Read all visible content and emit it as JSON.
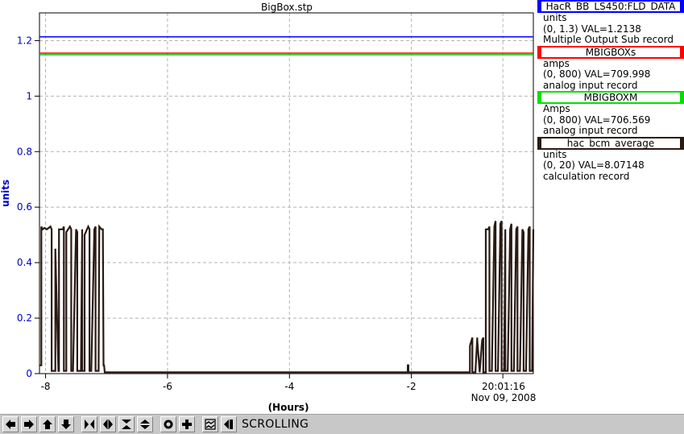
{
  "chart_data": {
    "type": "line",
    "title": "BigBox.stp",
    "xlabel": "(Hours)",
    "ylabel": "units",
    "xlim": [
      -8.1,
      0
    ],
    "ylim": [
      0,
      1.3
    ],
    "x_ticks": [
      "-8",
      "-6",
      "-4",
      "-2"
    ],
    "y_ticks": [
      "0",
      "0.2",
      "0.4",
      "0.6",
      "0.8",
      "1",
      "1.2"
    ],
    "time_label": "20:01:16",
    "date_label": "Nov 09, 2008",
    "grid": true,
    "series": [
      {
        "name": "HacR_BB_LS450:FLD_DATA",
        "color": "#0000ff",
        "x": [
          -8.1,
          0
        ],
        "y": [
          1.2138,
          1.2138
        ]
      },
      {
        "name": "MBIGBOXs",
        "color": "#ff0000",
        "x": [
          -8.1,
          0
        ],
        "y": [
          1.155,
          1.155
        ]
      },
      {
        "name": "MBIGBOXM",
        "color": "#00cc00",
        "x": [
          -8.1,
          0
        ],
        "y": [
          1.149,
          1.149
        ]
      },
      {
        "name": "hac_bcm_average",
        "color": "#2a1a12",
        "x": [
          -8.1,
          -8.07,
          -8.07,
          -8.05,
          -8.02,
          -7.98,
          -7.92,
          -7.9,
          -7.9,
          -7.85,
          -7.84,
          -7.84,
          -7.79,
          -7.78,
          -7.78,
          -7.72,
          -7.7,
          -7.7,
          -7.66,
          -7.66,
          -7.6,
          -7.58,
          -7.58,
          -7.55,
          -7.5,
          -7.48,
          -7.48,
          -7.42,
          -7.4,
          -7.4,
          -7.36,
          -7.36,
          -7.3,
          -7.28,
          -7.28,
          -7.25,
          -7.2,
          -7.18,
          -7.18,
          -7.13,
          -7.12,
          -7.12,
          -7.08,
          -7.06,
          -7.05,
          -7.04,
          -7.03,
          -6.5,
          -5.0,
          -3.0,
          -2.07,
          -2.06,
          -2.06,
          -2.05,
          -2.05,
          -1.5,
          -1.2,
          -1.05,
          -1.04,
          -1.04,
          -1.0,
          -1.0,
          -0.95,
          -0.92,
          -0.92,
          -0.88,
          -0.88,
          -0.84,
          -0.82,
          -0.82,
          -0.78,
          -0.78,
          -0.74,
          -0.72,
          -0.72,
          -0.68,
          -0.64,
          -0.62,
          -0.62,
          -0.58,
          -0.54,
          -0.52,
          -0.52,
          -0.48,
          -0.46,
          -0.46,
          -0.42,
          -0.38,
          -0.36,
          -0.36,
          -0.32,
          -0.28,
          -0.26,
          -0.26,
          -0.22,
          -0.18,
          -0.16,
          -0.16,
          -0.12,
          -0.08,
          -0.06,
          -0.06,
          -0.02,
          0
        ],
        "y": [
          0.03,
          0.03,
          0.53,
          0.52,
          0.525,
          0.52,
          0.53,
          0.52,
          0.01,
          0.01,
          0.01,
          0.45,
          0.01,
          0.01,
          0.52,
          0.52,
          0.53,
          0.01,
          0.01,
          0.51,
          0.53,
          0.52,
          0.01,
          0.01,
          0.52,
          0.51,
          0.01,
          0.01,
          0.52,
          0.01,
          0.01,
          0.5,
          0.53,
          0.52,
          0.01,
          0.01,
          0.52,
          0.53,
          0.01,
          0.01,
          0.51,
          0.53,
          0.52,
          0.52,
          0.03,
          0.03,
          0.005,
          0.005,
          0.005,
          0.005,
          0.005,
          0.005,
          0.03,
          0.03,
          0.005,
          0.005,
          0.005,
          0.005,
          0.005,
          0.1,
          0.13,
          0.005,
          0.005,
          0.13,
          0.12,
          0.005,
          0.005,
          0.12,
          0.13,
          0.005,
          0.005,
          0.52,
          0.52,
          0.53,
          0.01,
          0.01,
          0.53,
          0.55,
          0.01,
          0.01,
          0.54,
          0.55,
          0.01,
          0.01,
          0.52,
          0.01,
          0.01,
          0.52,
          0.54,
          0.01,
          0.01,
          0.52,
          0.53,
          0.01,
          0.01,
          0.52,
          0.51,
          0.01,
          0.01,
          0.52,
          0.53,
          0.01,
          0.01,
          0.52
        ]
      }
    ]
  },
  "legend": [
    {
      "name": "HacR_BB_LS450:FLD_DATA",
      "color": "#0000ff",
      "units": "units",
      "range": "(0, 1.3) VAL=1.2138",
      "type": "Multiple Output Sub record"
    },
    {
      "name": "MBIGBOXs",
      "color": "#ff0000",
      "units": "amps",
      "range": "(0, 800) VAL=709.998",
      "type": "analog input record"
    },
    {
      "name": "MBIGBOXM",
      "color": "#00e000",
      "units": "Amps",
      "range": "(0, 800) VAL=706.569",
      "type": "analog input record"
    },
    {
      "name": "hac_bcm_average",
      "color": "#2a1a12",
      "units": "units",
      "range": "(0, 20) VAL=8.07148",
      "type": "calculation record"
    }
  ],
  "toolbar": {
    "status": "SCROLLING",
    "buttons": [
      "pan-left-icon",
      "pan-right-icon",
      "pan-up-icon",
      "pan-down-icon",
      "zoom-in-x-icon",
      "zoom-out-x-icon",
      "zoom-in-y-icon",
      "zoom-out-y-icon",
      "auto-scale-icon",
      "reset-icon",
      "stagger-icon",
      "scroll-mode-icon"
    ]
  }
}
